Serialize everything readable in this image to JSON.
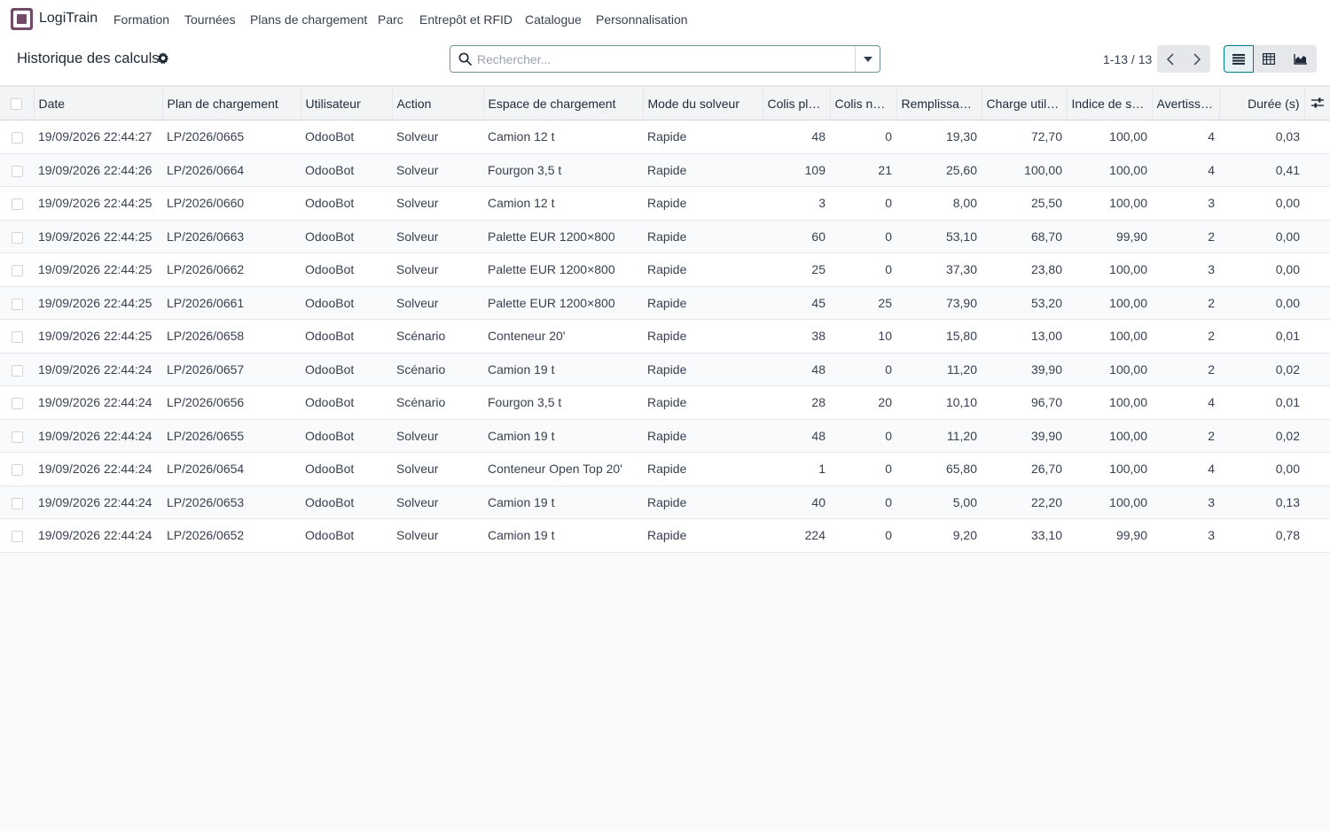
{
  "app": {
    "name": "LogiTrain"
  },
  "menu": [
    "Formation",
    "Tournées",
    "Plans de chargement",
    "Parc",
    "Entrepôt et RFID",
    "Catalogue",
    "Personnalisation"
  ],
  "control_panel": {
    "title": "Historique des calculs",
    "search_placeholder": "Rechercher...",
    "pager": "1-13 / 13"
  },
  "columns": [
    "Date",
    "Plan de chargement",
    "Utilisateur",
    "Action",
    "Espace de chargement",
    "Mode du solveur",
    "Colis placés",
    "Colis non placés",
    "Remplissage (%)",
    "Charge utile (%)",
    "Indice de stabilité",
    "Avertissements",
    "Durée (s)"
  ],
  "rows": [
    [
      "19/09/2026 22:44:27",
      "LP/2026/0665",
      "OdooBot",
      "Solveur",
      "Camion 12 t",
      "Rapide",
      "48",
      "0",
      "19,30",
      "72,70",
      "100,00",
      "4",
      "0,03"
    ],
    [
      "19/09/2026 22:44:26",
      "LP/2026/0664",
      "OdooBot",
      "Solveur",
      "Fourgon 3,5 t",
      "Rapide",
      "109",
      "21",
      "25,60",
      "100,00",
      "100,00",
      "4",
      "0,41"
    ],
    [
      "19/09/2026 22:44:25",
      "LP/2026/0660",
      "OdooBot",
      "Solveur",
      "Camion 12 t",
      "Rapide",
      "3",
      "0",
      "8,00",
      "25,50",
      "100,00",
      "3",
      "0,00"
    ],
    [
      "19/09/2026 22:44:25",
      "LP/2026/0663",
      "OdooBot",
      "Solveur",
      "Palette EUR 1200×800",
      "Rapide",
      "60",
      "0",
      "53,10",
      "68,70",
      "99,90",
      "2",
      "0,00"
    ],
    [
      "19/09/2026 22:44:25",
      "LP/2026/0662",
      "OdooBot",
      "Solveur",
      "Palette EUR 1200×800",
      "Rapide",
      "25",
      "0",
      "37,30",
      "23,80",
      "100,00",
      "3",
      "0,00"
    ],
    [
      "19/09/2026 22:44:25",
      "LP/2026/0661",
      "OdooBot",
      "Solveur",
      "Palette EUR 1200×800",
      "Rapide",
      "45",
      "25",
      "73,90",
      "53,20",
      "100,00",
      "2",
      "0,00"
    ],
    [
      "19/09/2026 22:44:25",
      "LP/2026/0658",
      "OdooBot",
      "Scénario",
      "Conteneur 20'",
      "Rapide",
      "38",
      "10",
      "15,80",
      "13,00",
      "100,00",
      "2",
      "0,01"
    ],
    [
      "19/09/2026 22:44:24",
      "LP/2026/0657",
      "OdooBot",
      "Scénario",
      "Camion 19 t",
      "Rapide",
      "48",
      "0",
      "11,20",
      "39,90",
      "100,00",
      "2",
      "0,02"
    ],
    [
      "19/09/2026 22:44:24",
      "LP/2026/0656",
      "OdooBot",
      "Scénario",
      "Fourgon 3,5 t",
      "Rapide",
      "28",
      "20",
      "10,10",
      "96,70",
      "100,00",
      "4",
      "0,01"
    ],
    [
      "19/09/2026 22:44:24",
      "LP/2026/0655",
      "OdooBot",
      "Solveur",
      "Camion 19 t",
      "Rapide",
      "48",
      "0",
      "11,20",
      "39,90",
      "100,00",
      "2",
      "0,02"
    ],
    [
      "19/09/2026 22:44:24",
      "LP/2026/0654",
      "OdooBot",
      "Solveur",
      "Conteneur Open Top 20'",
      "Rapide",
      "1",
      "0",
      "65,80",
      "26,70",
      "100,00",
      "4",
      "0,00"
    ],
    [
      "19/09/2026 22:44:24",
      "LP/2026/0653",
      "OdooBot",
      "Solveur",
      "Camion 19 t",
      "Rapide",
      "40",
      "0",
      "5,00",
      "22,20",
      "100,00",
      "3",
      "0,13"
    ],
    [
      "19/09/2026 22:44:24",
      "LP/2026/0652",
      "OdooBot",
      "Solveur",
      "Camion 19 t",
      "Rapide",
      "224",
      "0",
      "9,20",
      "33,10",
      "99,90",
      "3",
      "0,78"
    ]
  ],
  "colors": {
    "accent": "#017e84",
    "brand": "#714b67"
  },
  "icons": [
    "app-logo-icon",
    "gear-icon",
    "search-icon",
    "caret-down-icon",
    "chevron-left-icon",
    "chevron-right-icon",
    "list-view-icon",
    "pivot-view-icon",
    "graph-view-icon",
    "optional-columns-icon"
  ]
}
